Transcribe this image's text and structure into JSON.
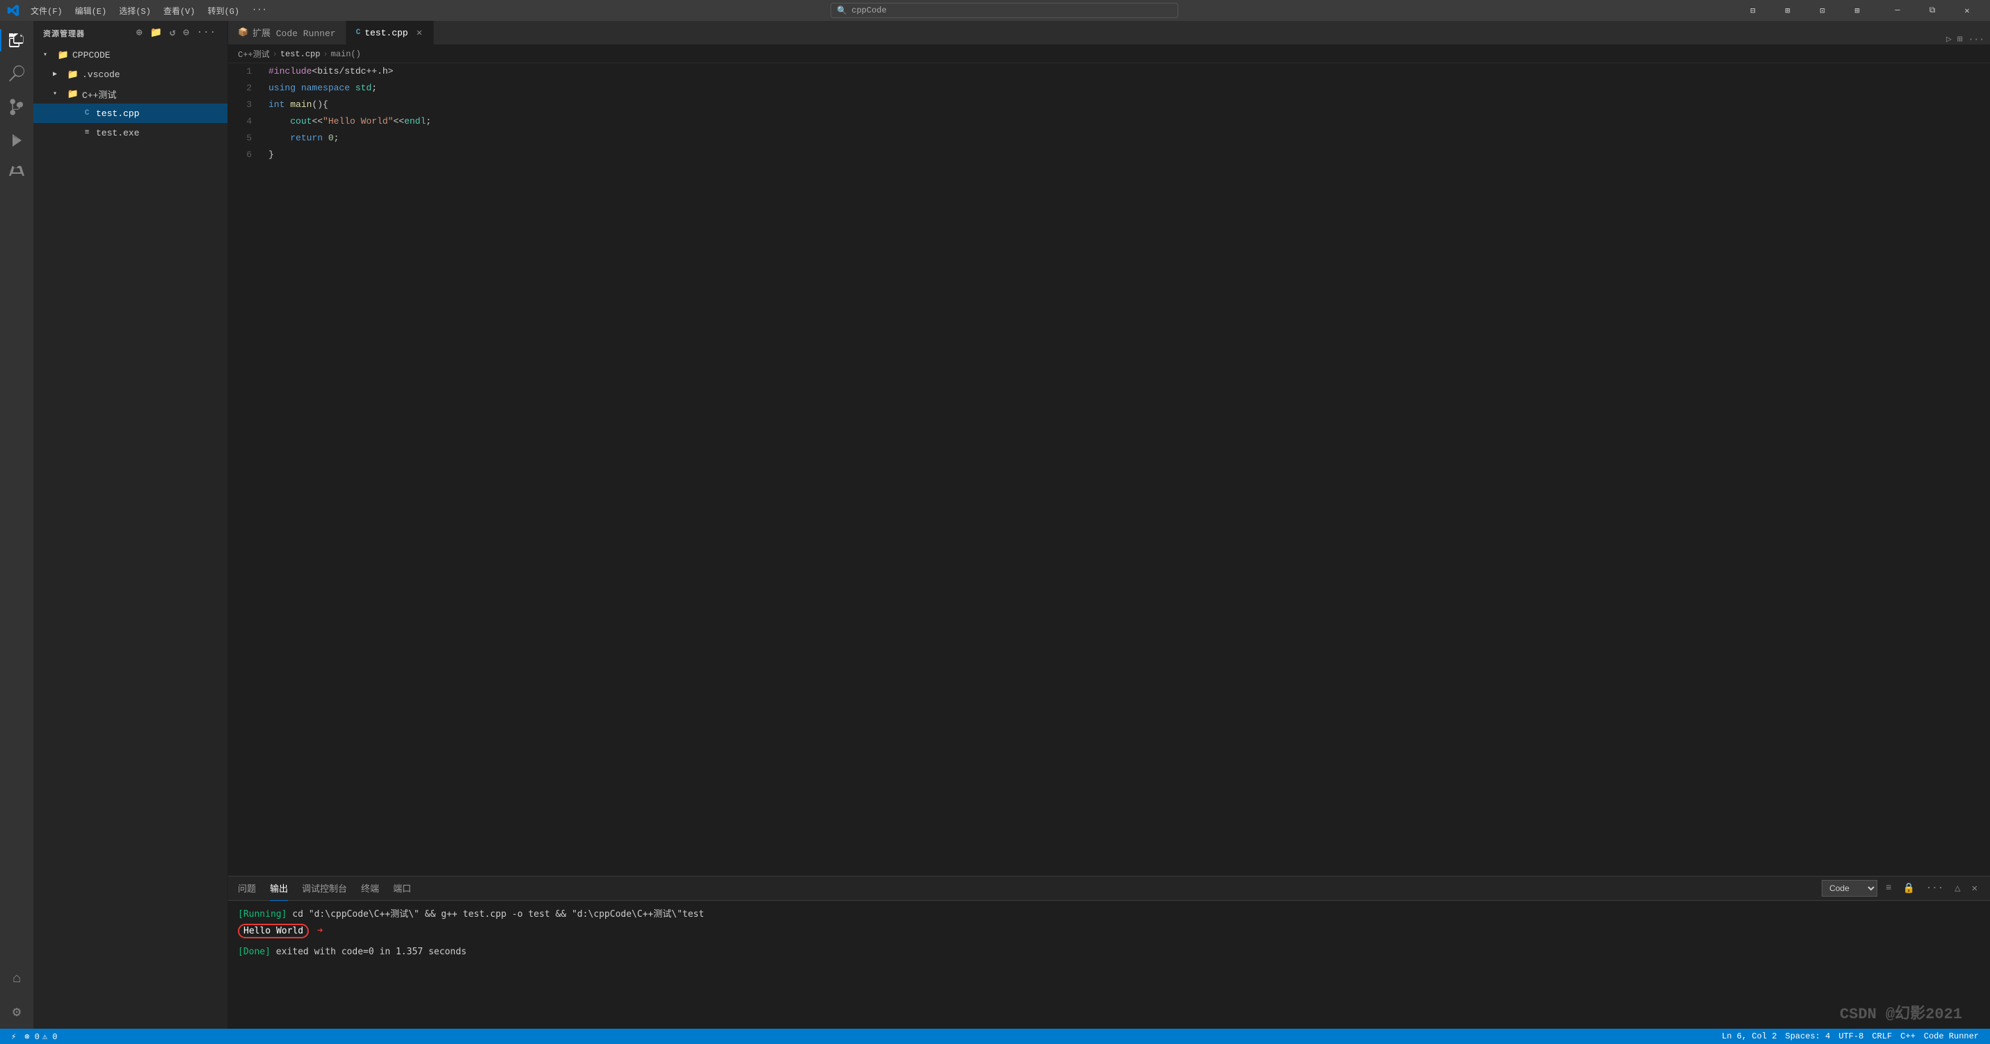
{
  "titleBar": {
    "menuItems": [
      "文件(F)",
      "编辑(E)",
      "选择(S)",
      "查看(V)",
      "转到(G)",
      "···"
    ],
    "searchPlaceholder": "cppCode",
    "controls": [
      "minimize",
      "restore",
      "close"
    ]
  },
  "activityBar": {
    "icons": [
      {
        "name": "explorer-icon",
        "symbol": "⎘",
        "active": true
      },
      {
        "name": "search-icon",
        "symbol": "🔍",
        "active": false
      },
      {
        "name": "source-control-icon",
        "symbol": "⎇",
        "active": false
      },
      {
        "name": "run-icon",
        "symbol": "▷",
        "active": false
      },
      {
        "name": "extensions-icon",
        "symbol": "⊞",
        "active": false
      }
    ],
    "bottomIcons": [
      {
        "name": "remote-icon",
        "symbol": "⌂"
      },
      {
        "name": "settings-icon",
        "symbol": "⚙"
      }
    ]
  },
  "sidebar": {
    "title": "资源管理器",
    "rootFolder": "CPPCODE",
    "items": [
      {
        "label": ".vscode",
        "type": "folder",
        "collapsed": true,
        "indent": 1
      },
      {
        "label": "C++测试",
        "type": "folder",
        "collapsed": false,
        "indent": 1
      },
      {
        "label": "test.cpp",
        "type": "file-cpp",
        "indent": 2,
        "active": true
      },
      {
        "label": "test.exe",
        "type": "file-exe",
        "indent": 2,
        "active": false
      }
    ]
  },
  "tabs": [
    {
      "label": "扩展 Code Runner",
      "icon": "📦",
      "active": false,
      "closable": false
    },
    {
      "label": "test.cpp",
      "icon": "C",
      "active": true,
      "closable": true
    }
  ],
  "breadcrumb": {
    "items": [
      "C++测试",
      "test.cpp",
      "main()"
    ]
  },
  "codeLines": [
    {
      "num": 1,
      "content": "#include<bits/stdc++.h>",
      "type": "include"
    },
    {
      "num": 2,
      "content": "using namespace std;",
      "type": "using"
    },
    {
      "num": 3,
      "content": "int main(){",
      "type": "main"
    },
    {
      "num": 4,
      "content": "    cout<<\"Hello World\"<<endl;",
      "type": "cout"
    },
    {
      "num": 5,
      "content": "    return 0;",
      "type": "return"
    },
    {
      "num": 6,
      "content": "}",
      "type": "close"
    }
  ],
  "panel": {
    "tabs": [
      "问题",
      "输出",
      "调试控制台",
      "终端",
      "端口"
    ],
    "activeTab": "输出",
    "dropdownValue": "Code",
    "lines": [
      {
        "type": "running",
        "content": "[Running] cd \"d:\\cppCode\\C++测试\\\" && g++ test.cpp -o test && \"d:\\cppCode\\C++测试\\\"test"
      },
      {
        "type": "output",
        "content": "Hello World"
      },
      {
        "type": "done",
        "content": "[Done] exited with code=0 in 1.357 seconds"
      }
    ]
  },
  "statusBar": {
    "left": [
      "⚡",
      "0 △ 0"
    ],
    "right": [
      "Ln 6, Col 2",
      "Spaces: 4",
      "UTF-8",
      "CRLF",
      "C++",
      "Code Runner"
    ]
  },
  "watermark": "CSDN @幻影2021"
}
